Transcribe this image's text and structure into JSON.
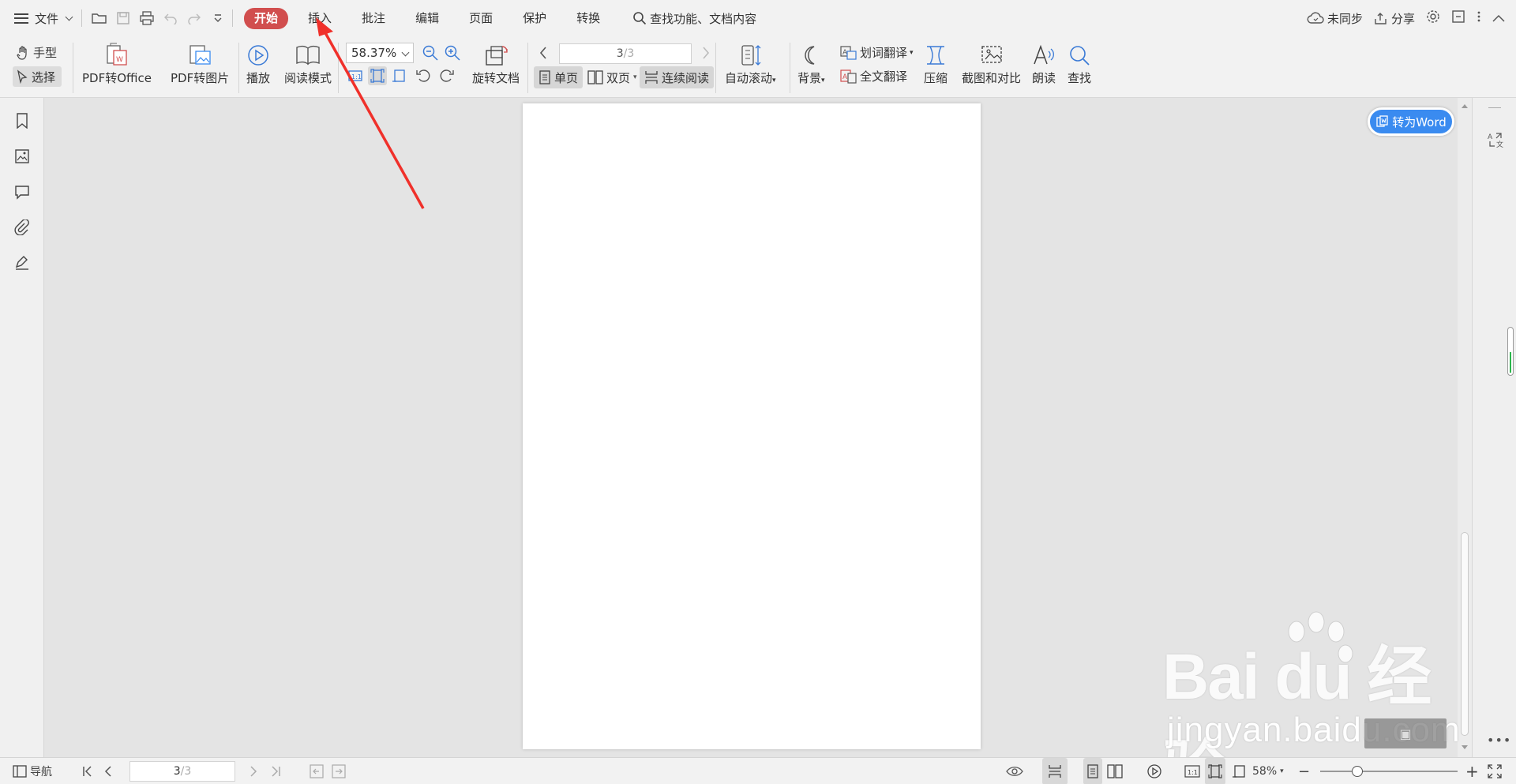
{
  "menu": {
    "file_label": "文件",
    "tabs": [
      "开始",
      "插入",
      "批注",
      "编辑",
      "页面",
      "保护",
      "转换"
    ],
    "search_label": "查找功能、文档内容",
    "sync_label": "未同步",
    "share_label": "分享"
  },
  "ribbon": {
    "hand": "手型",
    "select": "选择",
    "pdf_to_office": "PDF转Office",
    "pdf_to_image": "PDF转图片",
    "play": "播放",
    "read_mode": "阅读模式",
    "zoom": "58.37%",
    "rotate_doc": "旋转文档",
    "page_current": "3",
    "page_total": "/3",
    "single_page": "单页",
    "double_page": "双页",
    "continuous": "连续阅读",
    "auto_scroll": "自动滚动",
    "background": "背景",
    "word_translate": "划词翻译",
    "full_translate": "全文翻译",
    "compress": "压缩",
    "screenshot_compare": "截图和对比",
    "read_aloud": "朗读",
    "find": "查找"
  },
  "convert_word": "转为Word",
  "status": {
    "nav": "导航",
    "page_current": "3",
    "page_total": "/3",
    "zoom": "58%"
  },
  "watermark": {
    "logo": "Bai du 经验",
    "site": "jingyan.baidu.com"
  },
  "colors": {
    "active_tab": "#d14e4e",
    "convert_button": "#3a8bf0",
    "annotation_arrow": "#f0302a"
  }
}
